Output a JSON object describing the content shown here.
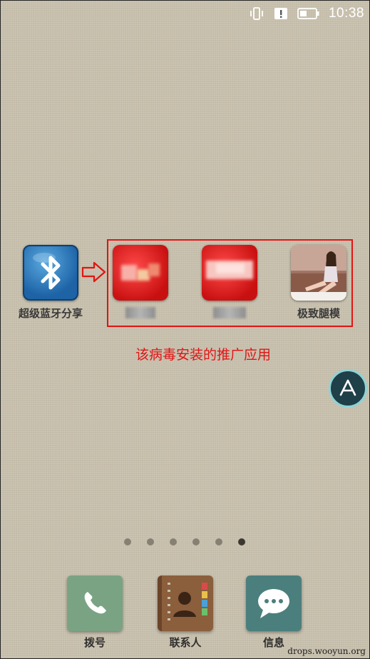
{
  "status_bar": {
    "time": "10:38",
    "icons": [
      "vibrate-icon",
      "alert-icon",
      "battery-icon"
    ]
  },
  "apps": [
    {
      "name": "bluetooth-share",
      "label": "超级蓝牙分享",
      "icon": "bluetooth-icon"
    },
    {
      "name": "promoted-app-1",
      "label": "",
      "label_obscured": true
    },
    {
      "name": "promoted-app-2",
      "label": "",
      "label_obscured": true
    },
    {
      "name": "promoted-app-3",
      "label": "极致腿模"
    }
  ],
  "annotation": {
    "caption": "该病毒安装的推广应用",
    "color": "#e01414"
  },
  "page_indicator": {
    "count": 6,
    "active_index": 5
  },
  "dock": [
    {
      "name": "dialer",
      "label": "拨号",
      "icon": "phone-icon",
      "color": "#7aa383"
    },
    {
      "name": "contacts",
      "label": "联系人",
      "icon": "contacts-book-icon",
      "color": "#8b5e3c"
    },
    {
      "name": "messages",
      "label": "信息",
      "icon": "chat-bubble-icon",
      "color": "#4b7f7d"
    }
  ],
  "watermark": "drops.wooyun.org"
}
